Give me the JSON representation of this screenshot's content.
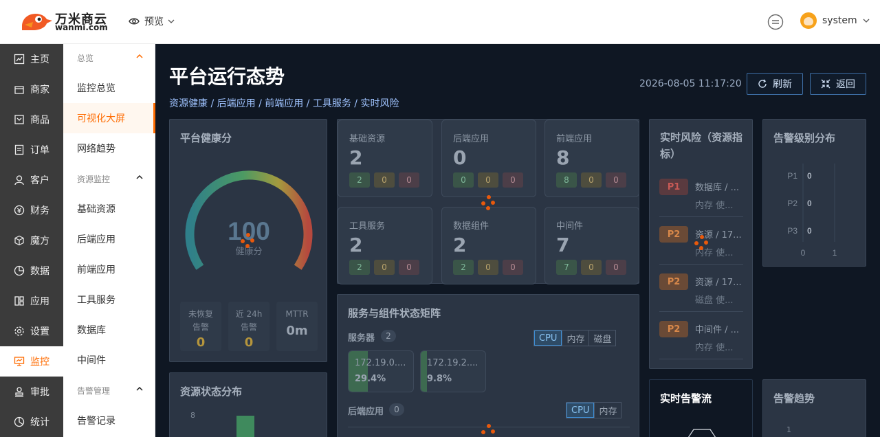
{
  "header": {
    "logo_text": "万米商云",
    "logo_sub": "wanmi.com",
    "preview_label": "预览",
    "user_name": "system"
  },
  "side_primary": [
    {
      "label": "主页",
      "icon": "home-icon"
    },
    {
      "label": "商家",
      "icon": "shop-icon"
    },
    {
      "label": "商品",
      "icon": "goods-icon"
    },
    {
      "label": "订单",
      "icon": "order-icon"
    },
    {
      "label": "客户",
      "icon": "customer-icon"
    },
    {
      "label": "财务",
      "icon": "finance-icon"
    },
    {
      "label": "魔方",
      "icon": "cube-icon"
    },
    {
      "label": "数据",
      "icon": "data-icon"
    },
    {
      "label": "应用",
      "icon": "app-icon"
    },
    {
      "label": "设置",
      "icon": "gear-icon"
    },
    {
      "label": "监控",
      "icon": "monitor-icon",
      "active": true
    },
    {
      "label": "审批",
      "icon": "approval-icon"
    },
    {
      "label": "统计",
      "icon": "stats-icon"
    }
  ],
  "side_secondary": {
    "group_overview": "总览",
    "item_monitor_overview": "监控总览",
    "item_visual_screen": "可视化大屏",
    "item_network_trend": "网络趋势",
    "group_resource": "资源监控",
    "item_base_resource": "基础资源",
    "item_backend_app": "后端应用",
    "item_frontend_app": "前端应用",
    "item_tool_service": "工具服务",
    "item_database": "数据库",
    "item_middleware": "中间件",
    "group_alert": "告警管理",
    "item_alert_records": "告警记录"
  },
  "main": {
    "title": "平台运行态势",
    "breadcrumb": "资源健康 / 后端应用 / 前端应用 / 工具服务 / 实时风险",
    "datetime": "2026-08-05 11:17:20",
    "refresh_label": "刷新",
    "back_label": "返回"
  },
  "health": {
    "title": "平台健康分",
    "score": "100",
    "score_label": "健康分",
    "stats": [
      {
        "label1": "未恢复",
        "label2": "告警",
        "value": "0"
      },
      {
        "label1": "近 24h",
        "label2": "告警",
        "value": "0"
      },
      {
        "label1": "MTTR",
        "label2": "",
        "value": "0m"
      }
    ]
  },
  "resource_cards": [
    {
      "title": "基础资源",
      "value": "2",
      "ok": "2",
      "warn": "0",
      "err": "0"
    },
    {
      "title": "后端应用",
      "value": "0",
      "ok": "0",
      "warn": "0",
      "err": "0"
    },
    {
      "title": "前端应用",
      "value": "8",
      "ok": "8",
      "warn": "0",
      "err": "0"
    },
    {
      "title": "工具服务",
      "value": "2",
      "ok": "2",
      "warn": "0",
      "err": "0"
    },
    {
      "title": "数据组件",
      "value": "2",
      "ok": "2",
      "warn": "0",
      "err": "0"
    },
    {
      "title": "中间件",
      "value": "7",
      "ok": "7",
      "warn": "0",
      "err": "0"
    }
  ],
  "risk": {
    "title_line1": "实时风险（资源指",
    "title_line2": "标）",
    "items": [
      {
        "level": "P1",
        "title": "数据库 / ...",
        "sub": "内存 使..."
      },
      {
        "level": "P2",
        "title": "资源 / 17...",
        "sub": "内存 使..."
      },
      {
        "level": "P2",
        "title": "资源 / 17...",
        "sub": "磁盘 使..."
      },
      {
        "level": "P2",
        "title": "中间件 / ...",
        "sub": "内存 使..."
      }
    ]
  },
  "alert_level": {
    "title": "告警级别分布",
    "levels": [
      "P1",
      "P2",
      "P3"
    ],
    "values": [
      "0",
      "0",
      "0"
    ],
    "x_ticks": [
      "0",
      "1"
    ]
  },
  "matrix": {
    "title": "服务与组件状态矩阵",
    "server_label": "服务器",
    "server_count": "2",
    "server_tabs": [
      "CPU",
      "内存",
      "磁盘"
    ],
    "servers": [
      {
        "ip": "172.19.0....",
        "pct": "29.4%",
        "fill": 0.294
      },
      {
        "ip": "172.19.2....",
        "pct": "9.8%",
        "fill": 0.098
      }
    ],
    "backend_label": "后端应用",
    "backend_count": "0",
    "backend_tabs": [
      "CPU",
      "内存"
    ]
  },
  "resource_dist": {
    "title": "资源状态分布",
    "y_tick": "8"
  },
  "realtime_alert": {
    "title": "实时告警流"
  },
  "alert_trend": {
    "title": "告警趋势",
    "y_tick": "1"
  },
  "colors": {
    "accent": "#ff6b00",
    "dashboard_bg": "#0f1723",
    "sidebar_bg": "#3b3b3b"
  }
}
